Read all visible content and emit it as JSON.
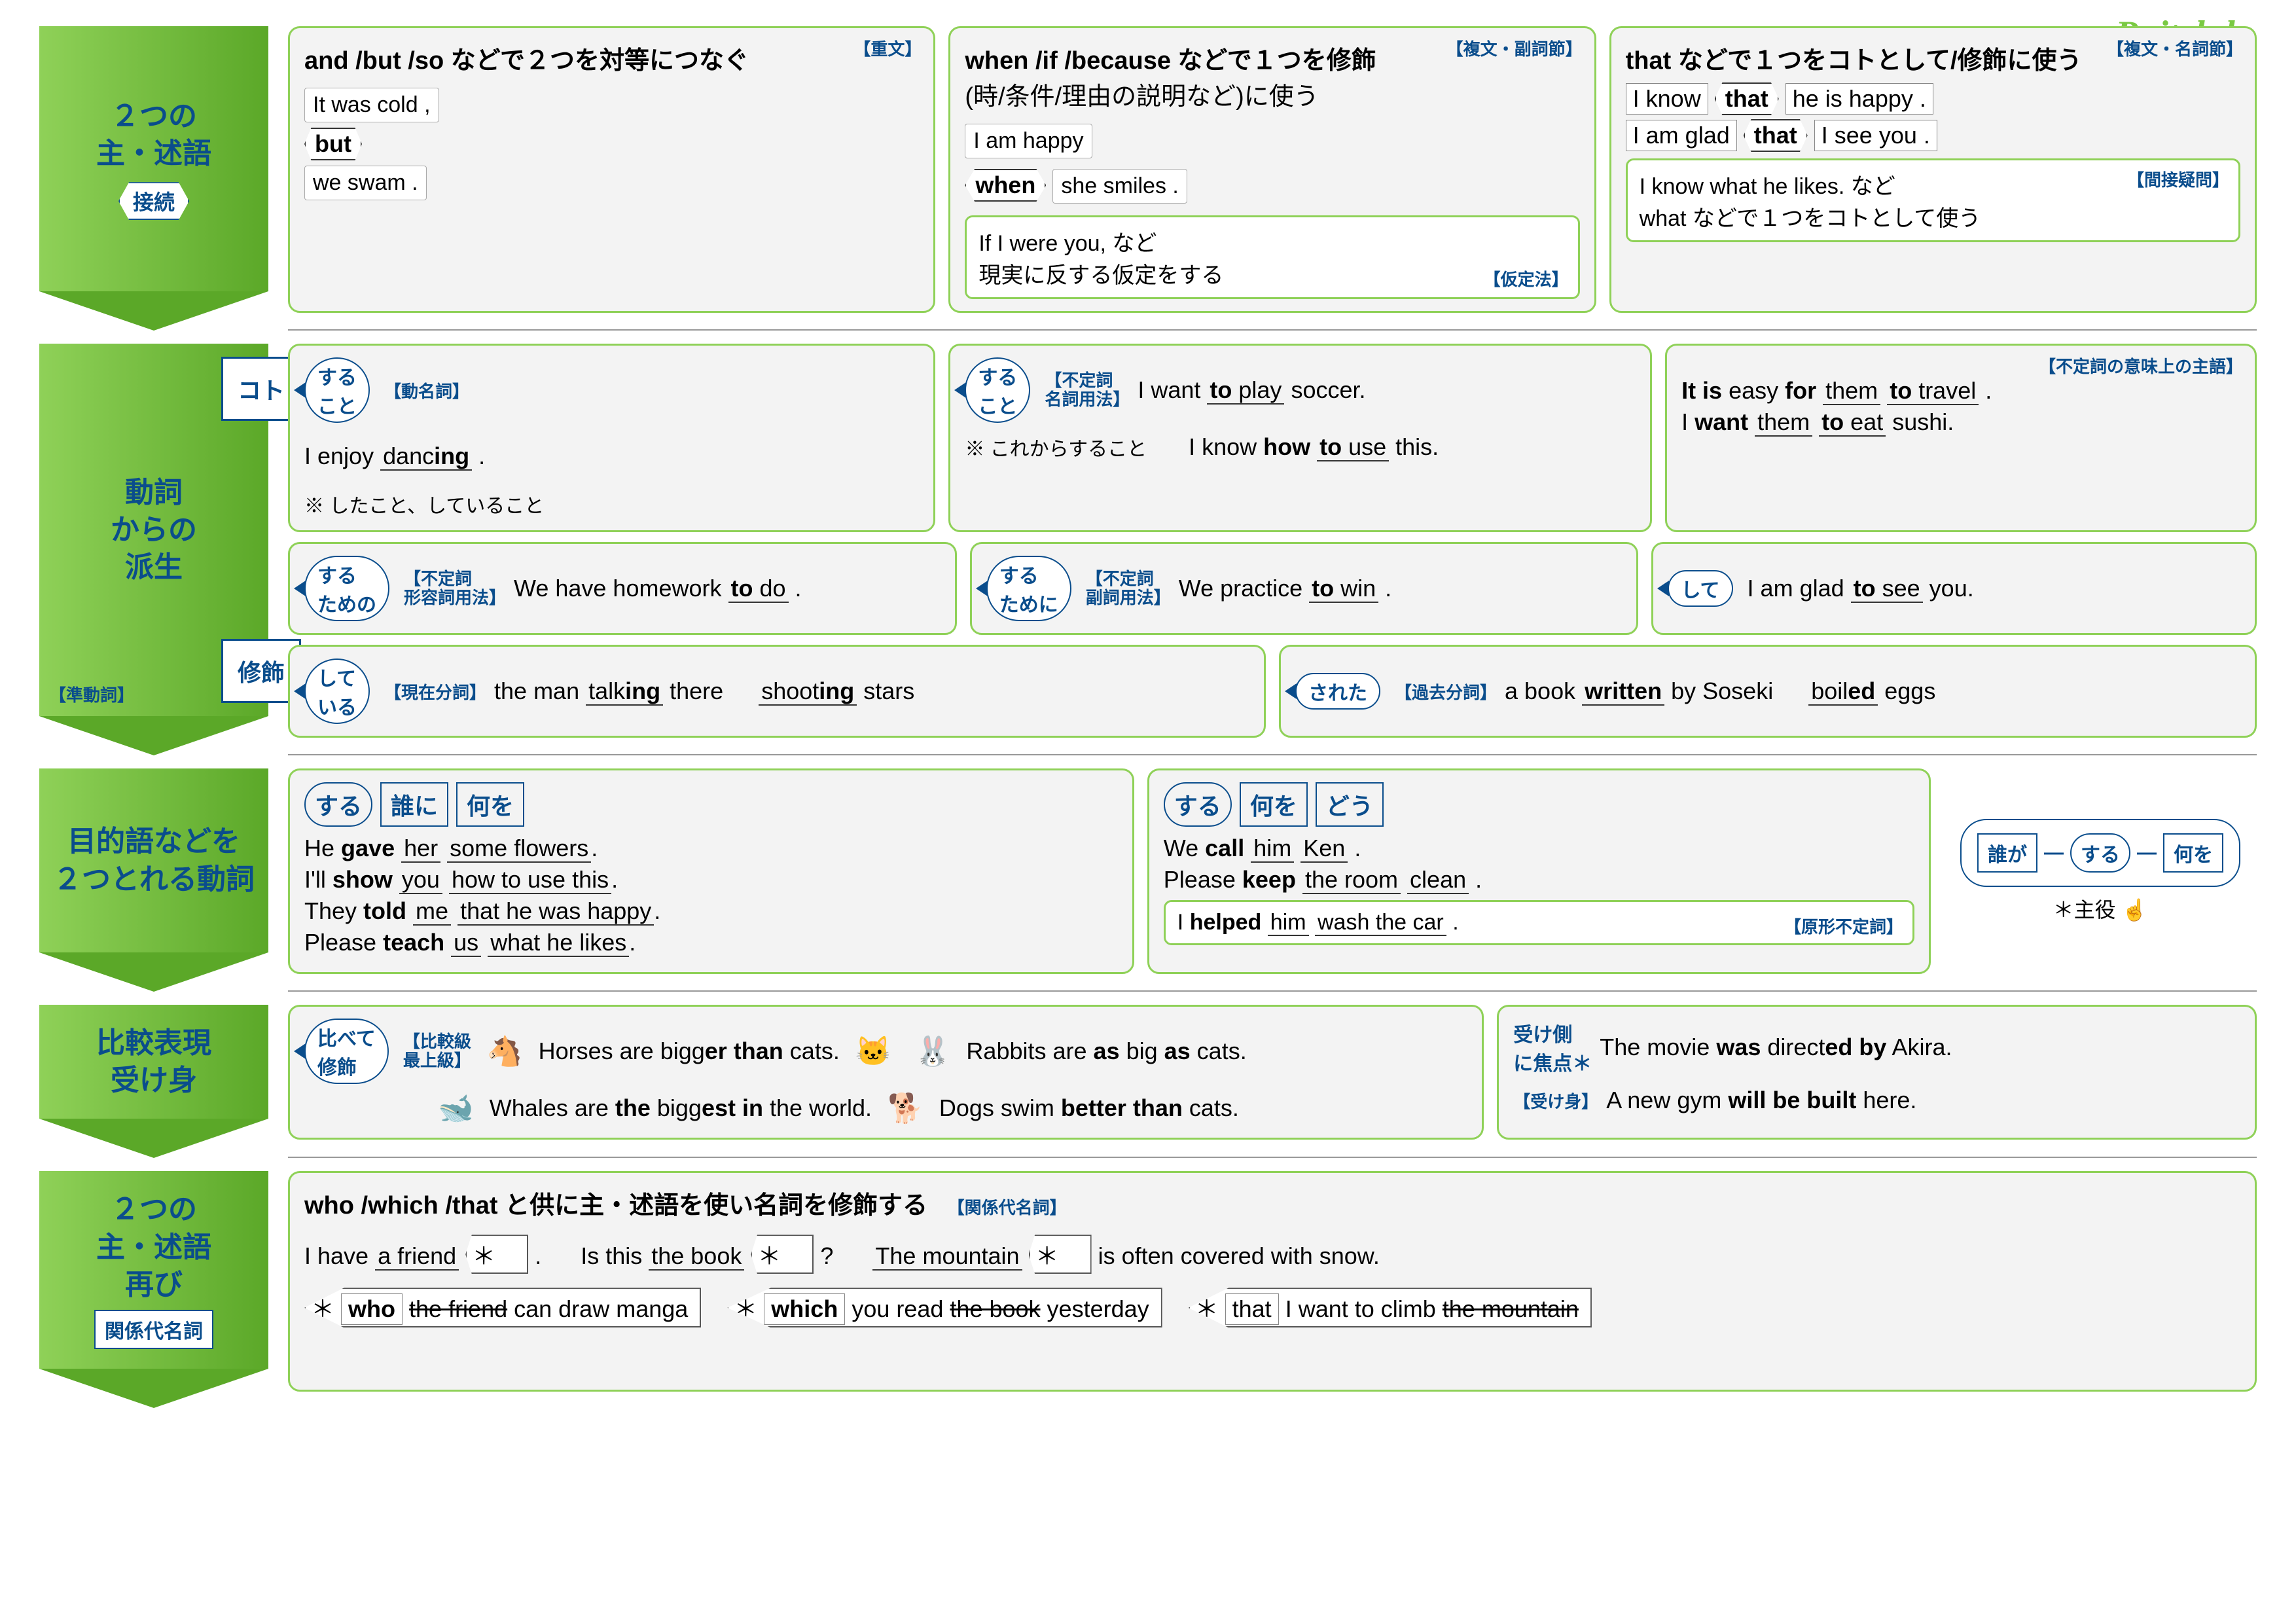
{
  "logo": "Raitclub",
  "row1": {
    "title": "２つの\n主・述語",
    "diamond": "接続",
    "p1": {
      "title": "and /but /so などで２つを対等につなぐ",
      "tag": "【重文】",
      "l1": "It was cold ,",
      "conj": "but",
      "l2": "we swam ."
    },
    "p2": {
      "title": "when /if /because などで１つを修飾",
      "title2": "(時/条件/理由の説明など)に使う",
      "tag": "【複文・副詞節】",
      "l1": "I am happy",
      "conj": "when",
      "l2": "she smiles .",
      "sub_text": "If I were you, など\n現実に反する仮定をする",
      "sub_tag": "【仮定法】"
    },
    "p3": {
      "title": "that などで１つをコトとして/修飾に使う",
      "tag": "【複文・名詞節】",
      "l1a": "I know",
      "l1b": "that",
      "l1c": "he is happy .",
      "l2a": "I am glad",
      "l2b": "that",
      "l2c": "I see you .",
      "sub_text": "I know what he likes. など\nwhat などで１つをコトとして使う",
      "sub_tag": "【間接疑問】"
    }
  },
  "row2": {
    "title": "動詞\nからの\n派生",
    "note": "【準動詞】",
    "tab1": "コト",
    "tab2": "修飾",
    "koto1": {
      "bubble": "する\nこと",
      "bubble_tag": "【動名詞】",
      "ex": "I enjoy dancing .",
      "note": "※ したこと、していること"
    },
    "koto2": {
      "bubble": "する\nこと",
      "bubble_tag": "【不定詞\n名詞用法】",
      "ex1": "I want to play soccer.",
      "note": "※ これからすること",
      "ex2": "I know how to use this."
    },
    "koto3": {
      "tag": "【不定詞の意味上の主語】",
      "ex1": "It is easy for them to travel .",
      "ex2": "I want them to eat sushi."
    },
    "mod1": {
      "bubble": "する\nための",
      "tag": "【不定詞\n形容詞用法】",
      "ex": "We have homework to do ."
    },
    "mod2": {
      "bubble": "する\nために",
      "tag": "【不定詞\n副詞用法】",
      "ex": "We practice to win ."
    },
    "mod3": {
      "bubble": "して",
      "ex": "I am glad to see you."
    },
    "mod4": {
      "bubble": "して\nいる",
      "tag": "【現在分詞】",
      "ex1": "the man talking there",
      "ex2": "shooting stars"
    },
    "mod5": {
      "bubble": "された",
      "tag": "【過去分詞】",
      "ex1": "a book written by Soseki",
      "ex2": "boiled eggs"
    }
  },
  "row3": {
    "title": "目的語などを\n２つとれる動詞",
    "p1": {
      "b1": "する",
      "b2": "誰に",
      "b3": "何を",
      "e1": "He gave her some flowers.",
      "e2": "I'll show you how to use this.",
      "e3": "They told me that he was happy.",
      "e4": "Please teach us what he likes."
    },
    "p2": {
      "b1": "する",
      "b2": "何を",
      "b3": "どう",
      "e1": "We call him Ken .",
      "e2": "Please keep the room clean .",
      "sub": "I helped him wash the car .",
      "sub_tag": "【原形不定詞】"
    },
    "schema": {
      "a": "誰が",
      "b": "する",
      "c": "何を",
      "note": "＊主役 ☝"
    }
  },
  "row4": {
    "title": "比較表現\n受け身",
    "p1": {
      "bubble": "比べて\n修飾",
      "tag": "【比較級\n最上級】",
      "e1": "Horses are bigger than cats.",
      "e2": "Rabbits are as big as cats.",
      "e3": "Whales are the biggest in the world.",
      "e4": "Dogs swim better than cats."
    },
    "p2": {
      "label": "受け側\nに焦点＊",
      "tag": "【受け身】",
      "e1": "The movie was directed by Akira.",
      "e2": "A new gym will be built here."
    }
  },
  "row5": {
    "title": "２つの\n主・述語\n再び",
    "rect": "関係代名詞",
    "panel": {
      "title": "who /which /that と供に主・述語を使い名詞を修飾する",
      "tag": "【関係代名詞】",
      "e1a": "I have a friend",
      "e1b": "＊",
      "e1c": ".",
      "e2a": "Is this the book",
      "e2b": "＊",
      "e2c": "?",
      "e3a": "The mountain",
      "e3b": "＊",
      "e3c": "is often covered with snow.",
      "s1": "who  the friend can draw manga",
      "s2": "which  you read the book yesterday",
      "s3": "that  I want to climb the mountain"
    }
  }
}
